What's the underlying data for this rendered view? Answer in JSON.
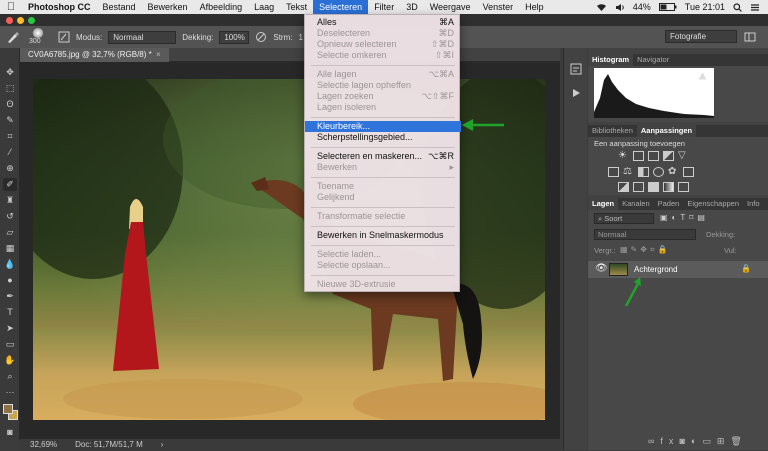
{
  "menubar": {
    "app_name": "Photoshop CC",
    "items": [
      "Bestand",
      "Bewerken",
      "Afbeelding",
      "Laag",
      "Tekst",
      "Selecteren",
      "Filter",
      "3D",
      "Weergave",
      "Venster",
      "Help"
    ],
    "active_item": "Selecteren",
    "status": {
      "battery_percent": "44%",
      "clock": "Tue 21:01"
    }
  },
  "options_bar": {
    "brush_size": "300",
    "mode_label": "Modus:",
    "mode_value": "Normaal",
    "opacity_label": "Dekking:",
    "opacity_value": "100%",
    "flow_label": "Strm:",
    "flow_value": "1",
    "workspace": "Fotografie"
  },
  "document": {
    "tab_title": "CV0A6785.jpg @ 32,7% (RGB/8) *",
    "zoom": "32,69%",
    "doc_size": "Doc: 51,7M/51,7 M"
  },
  "selecteren_menu": {
    "items": [
      {
        "label": "Alles",
        "shortcut": "⌘A",
        "enabled": true
      },
      {
        "label": "Deselecteren",
        "shortcut": "⌘D",
        "enabled": false
      },
      {
        "label": "Opnieuw selecteren",
        "shortcut": "⇧⌘D",
        "enabled": false
      },
      {
        "label": "Selectie omkeren",
        "shortcut": "⇧⌘I",
        "enabled": false
      },
      {
        "label": "Alle lagen",
        "shortcut": "⌥⌘A",
        "enabled": false
      },
      {
        "label": "Selectie lagen opheffen",
        "shortcut": "",
        "enabled": false
      },
      {
        "label": "Lagen zoeken",
        "shortcut": "⌥⇧⌘F",
        "enabled": false
      },
      {
        "label": "Lagen isoleren",
        "shortcut": "",
        "enabled": false
      },
      {
        "label": "Kleurbereik...",
        "shortcut": "",
        "enabled": true,
        "highlighted": true
      },
      {
        "label": "Scherpstellingsgebied...",
        "shortcut": "",
        "enabled": true
      },
      {
        "label": "Selecteren en maskeren...",
        "shortcut": "⌥⌘R",
        "enabled": true
      },
      {
        "label": "Bewerken",
        "shortcut": "▸",
        "enabled": false
      },
      {
        "label": "Toename",
        "shortcut": "",
        "enabled": false
      },
      {
        "label": "Gelijkend",
        "shortcut": "",
        "enabled": false
      },
      {
        "label": "Transformatie selectie",
        "shortcut": "",
        "enabled": false
      },
      {
        "label": "Bewerken in Snelmaskermodus",
        "shortcut": "",
        "enabled": true
      },
      {
        "label": "Selectie laden...",
        "shortcut": "",
        "enabled": false
      },
      {
        "label": "Selectie opslaan...",
        "shortcut": "",
        "enabled": false
      },
      {
        "label": "Nieuwe 3D-extrusie",
        "shortcut": "",
        "enabled": false
      }
    ]
  },
  "panels": {
    "histogram_tabs": [
      "Histogram",
      "Navigator"
    ],
    "adjust_tabs": [
      "Bibliotheken",
      "Aanpassingen"
    ],
    "adjust_hint": "Een aanpassing toevoegen",
    "layer_tabs": [
      "Lagen",
      "Kanalen",
      "Paden",
      "Eigenschappen",
      "Info"
    ],
    "layer_search": "Soort",
    "blend_mode": "Normaal",
    "opacity_label": "Dekking:",
    "lock_label": "Vergr.:",
    "fill_label": "Vul:",
    "layer_name": "Achtergrond"
  },
  "colors": {
    "menu_highlight": "#2f74da",
    "annotation_arrow": "#1fa32a",
    "dress_red": "#b3161b"
  }
}
